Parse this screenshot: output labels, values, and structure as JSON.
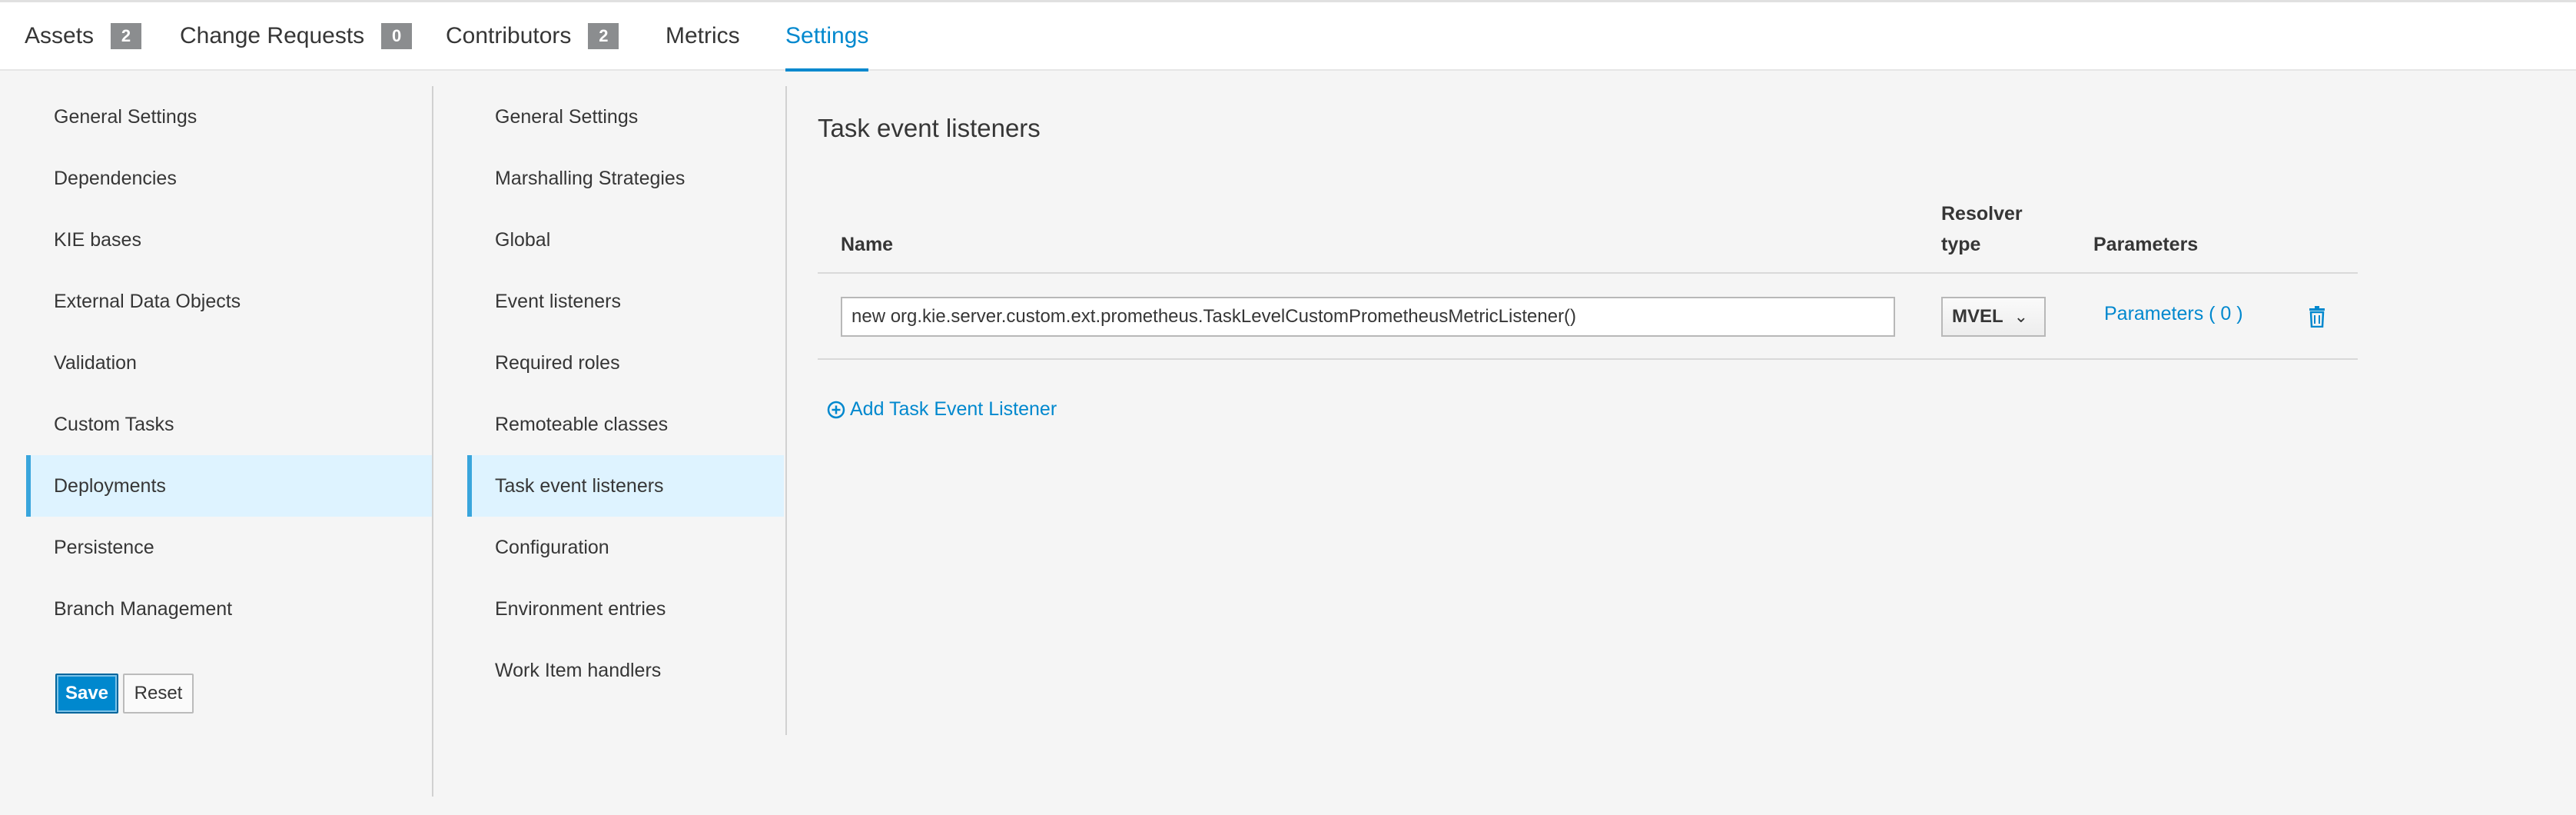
{
  "tabs": [
    {
      "label": "Assets",
      "badge": "2"
    },
    {
      "label": "Change Requests",
      "badge": "0"
    },
    {
      "label": "Contributors",
      "badge": "2"
    },
    {
      "label": "Metrics"
    },
    {
      "label": "Settings",
      "active": true
    }
  ],
  "settings_nav": {
    "items": [
      "General Settings",
      "Dependencies",
      "KIE bases",
      "External Data Objects",
      "Validation",
      "Custom Tasks",
      "Deployments",
      "Persistence",
      "Branch Management"
    ],
    "active": "Deployments",
    "save_label": "Save",
    "reset_label": "Reset"
  },
  "deployment_nav": {
    "items": [
      "General Settings",
      "Marshalling Strategies",
      "Global",
      "Event listeners",
      "Required roles",
      "Remoteable classes",
      "Task event listeners",
      "Configuration",
      "Environment entries",
      "Work Item handlers"
    ],
    "active": "Task event listeners"
  },
  "main": {
    "title": "Task event listeners",
    "columns": {
      "name": "Name",
      "resolver_line1": "Resolver",
      "resolver_line2": "type",
      "parameters": "Parameters"
    },
    "rows": [
      {
        "name": "new org.kie.server.custom.ext.prometheus.TaskLevelCustomPrometheusMetricListener()",
        "resolver": "MVEL",
        "parameters": "Parameters ( 0 )"
      }
    ],
    "add_label": "Add Task Event Listener"
  },
  "colors": {
    "accent": "#0088ce",
    "active_bg": "#def3ff",
    "badge": "#8b8d8f"
  }
}
